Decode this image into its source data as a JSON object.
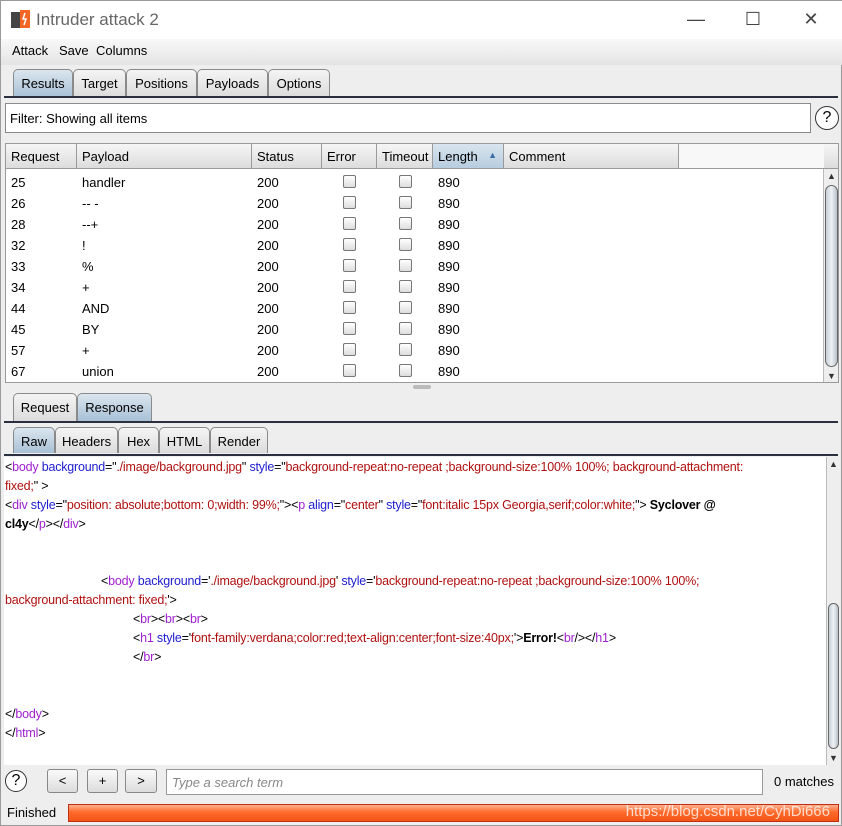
{
  "window": {
    "title": "Intruder attack 2",
    "minimize": "—",
    "maximize": "☐",
    "close": "✕"
  },
  "menu": [
    "Attack",
    "Save",
    "Columns"
  ],
  "tabs": [
    "Results",
    "Target",
    "Positions",
    "Payloads",
    "Options"
  ],
  "filter": "Filter: Showing all items",
  "help": "?",
  "table": {
    "columns": [
      "Request",
      "Payload",
      "Status",
      "Error",
      "Timeout",
      "Length",
      "Comment"
    ],
    "sort_indicator": "▲",
    "rows": [
      {
        "request": "25",
        "payload": "handler",
        "status": "200",
        "error": false,
        "timeout": false,
        "length": "890",
        "comment": ""
      },
      {
        "request": "26",
        "payload": "-- -",
        "status": "200",
        "error": false,
        "timeout": false,
        "length": "890",
        "comment": ""
      },
      {
        "request": "28",
        "payload": "--+",
        "status": "200",
        "error": false,
        "timeout": false,
        "length": "890",
        "comment": ""
      },
      {
        "request": "32",
        "payload": "!",
        "status": "200",
        "error": false,
        "timeout": false,
        "length": "890",
        "comment": ""
      },
      {
        "request": "33",
        "payload": "%",
        "status": "200",
        "error": false,
        "timeout": false,
        "length": "890",
        "comment": ""
      },
      {
        "request": "34",
        "payload": "+",
        "status": "200",
        "error": false,
        "timeout": false,
        "length": "890",
        "comment": ""
      },
      {
        "request": "44",
        "payload": "AND",
        "status": "200",
        "error": false,
        "timeout": false,
        "length": "890",
        "comment": ""
      },
      {
        "request": "45",
        "payload": "BY",
        "status": "200",
        "error": false,
        "timeout": false,
        "length": "890",
        "comment": ""
      },
      {
        "request": "57",
        "payload": "+",
        "status": "200",
        "error": false,
        "timeout": false,
        "length": "890",
        "comment": ""
      },
      {
        "request": "67",
        "payload": "union",
        "status": "200",
        "error": false,
        "timeout": false,
        "length": "890",
        "comment": ""
      }
    ]
  },
  "msg_tabs": [
    "Request",
    "Response"
  ],
  "view_tabs": [
    "Raw",
    "Headers",
    "Hex",
    "HTML",
    "Render"
  ],
  "code_lines": [
    [
      [
        "t",
        "<"
      ],
      [
        "n",
        "body"
      ],
      [
        "a",
        " background"
      ],
      [
        "t",
        "=\""
      ],
      [
        "v",
        "./image/background.jpg"
      ],
      [
        "t",
        "\" "
      ],
      [
        "a",
        "style"
      ],
      [
        "t",
        "=\""
      ],
      [
        "v",
        "background-repeat:no-repeat ;background-size:100% 100%; background-attachment:"
      ]
    ],
    [
      [
        "v",
        "fixed;"
      ],
      [
        "t",
        "\" >"
      ]
    ],
    [
      [
        "t",
        "<"
      ],
      [
        "n",
        "div"
      ],
      [
        "a",
        " style"
      ],
      [
        "t",
        "=\""
      ],
      [
        "v",
        "position: absolute;bottom: 0;width: 99%;"
      ],
      [
        "t",
        "\"><"
      ],
      [
        "n",
        "p"
      ],
      [
        "a",
        " align"
      ],
      [
        "t",
        "=\""
      ],
      [
        "v",
        "center"
      ],
      [
        "t",
        "\" "
      ],
      [
        "a",
        "style"
      ],
      [
        "t",
        "=\""
      ],
      [
        "v",
        "font:italic 15px Georgia,serif;color:white;"
      ],
      [
        "t",
        "\"> "
      ],
      [
        "x",
        "Syclover @"
      ]
    ],
    [
      [
        "x",
        "cl4y"
      ],
      [
        "t",
        "</"
      ],
      [
        "n",
        "p"
      ],
      [
        "t",
        "></"
      ],
      [
        "n",
        "div"
      ],
      [
        "t",
        ">"
      ]
    ],
    [],
    [],
    [
      [
        "t",
        "\t\t\t<"
      ],
      [
        "n",
        "body"
      ],
      [
        "a",
        " background"
      ],
      [
        "t",
        "='"
      ],
      [
        "v",
        "./image/background.jpg"
      ],
      [
        "t",
        "' "
      ],
      [
        "a",
        "style"
      ],
      [
        "t",
        "='"
      ],
      [
        "v",
        "background-repeat:no-repeat ;background-size:100% 100%;"
      ]
    ],
    [
      [
        "v",
        "background-attachment: fixed;"
      ],
      [
        "t",
        "'>"
      ]
    ],
    [
      [
        "t",
        "\t\t\t\t<"
      ],
      [
        "n",
        "br"
      ],
      [
        "t",
        "><"
      ],
      [
        "n",
        "br"
      ],
      [
        "t",
        "><"
      ],
      [
        "n",
        "br"
      ],
      [
        "t",
        ">"
      ]
    ],
    [
      [
        "t",
        "\t\t\t\t<"
      ],
      [
        "n",
        "h1"
      ],
      [
        "a",
        " style"
      ],
      [
        "t",
        "='"
      ],
      [
        "v",
        "font-family:verdana;color:red;text-align:center;font-size:40px;"
      ],
      [
        "t",
        "'>"
      ],
      [
        "x",
        "Error!"
      ],
      [
        "t",
        "<"
      ],
      [
        "n",
        "br"
      ],
      [
        "t",
        "/></"
      ],
      [
        "n",
        "h1"
      ],
      [
        "t",
        ">"
      ]
    ],
    [
      [
        "t",
        "\t\t\t\t</"
      ],
      [
        "n",
        "br"
      ],
      [
        "t",
        ">"
      ]
    ],
    [],
    [],
    [
      [
        "t",
        "</"
      ],
      [
        "n",
        "body"
      ],
      [
        "t",
        ">"
      ]
    ],
    [
      [
        "t",
        "</"
      ],
      [
        "n",
        "html"
      ],
      [
        "t",
        ">"
      ]
    ]
  ],
  "search": {
    "prev": "<",
    "add": "+",
    "next": ">",
    "placeholder": "Type a search term",
    "value": "",
    "matches": "0 matches"
  },
  "status": {
    "text": "Finished",
    "progress_percent": 100,
    "watermark": "https://blog.csdn.net/CyhDi666"
  },
  "colors": {
    "progress": "#ff6a2a",
    "tag_name": "#a020d0",
    "attr": "#2020d0",
    "value": "#b01010"
  }
}
